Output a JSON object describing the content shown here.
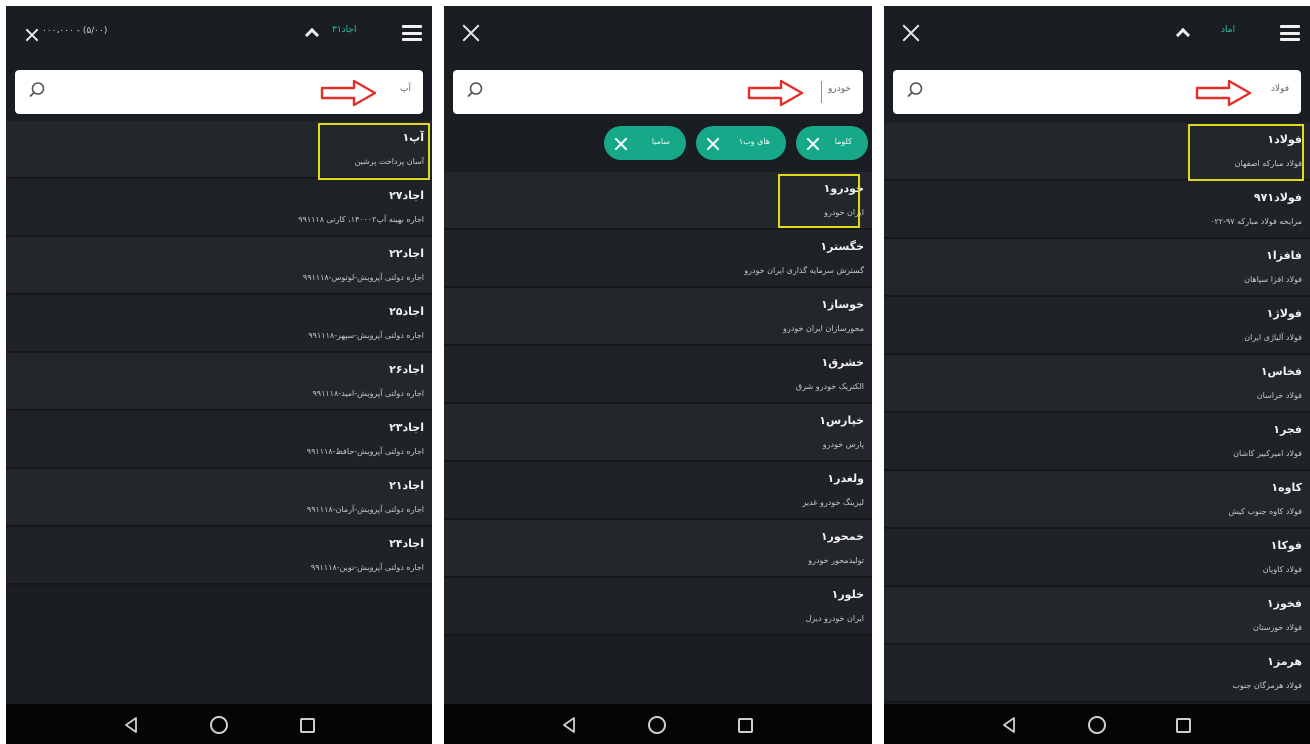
{
  "panel1": {
    "status_text": "۰۰۰،۰۰۰ - (۵/۰۰)",
    "pill_label": "اجاد۳۱",
    "search_query": "آپ",
    "items": [
      {
        "symbol": "آپ۱",
        "name": "آسان پرداخت پرشین"
      },
      {
        "symbol": "اجاد۲۷",
        "name": "اجاره بهینه آپ۱۴۰۰۰۲، کارتی ۹۹۱۱۱۸"
      },
      {
        "symbol": "اجاد۲۲",
        "name": "اجاره دولتی آپرویش-لوتوس-۹۹۱۱۱۸"
      },
      {
        "symbol": "اجاد۲۵",
        "name": "اجاره دولتی آپرویش-سپهر-۹۹۱۱۱۸"
      },
      {
        "symbol": "اجاد۲۶",
        "name": "اجاره دولتی آپرویش-امید-۹۹۱۱۱۸"
      },
      {
        "symbol": "اجاد۲۳",
        "name": "اجاره دولتی آپرویش-حافظ-۹۹۱۱۱۸"
      },
      {
        "symbol": "اجاد۲۱",
        "name": "اجاره دولتی آپرویش-آرمان-۹۹۱۱۱۸"
      },
      {
        "symbol": "اجاد۲۴",
        "name": "اجاره دولتی آپرویش-نوین-۹۹۱۱۱۸"
      }
    ]
  },
  "panel2": {
    "search_query": "خودرو",
    "chips": [
      "کلوما",
      "های وب۱",
      "سامیا"
    ],
    "items": [
      {
        "symbol": "خودرو۱",
        "name": "ایران خودرو"
      },
      {
        "symbol": "خگستر۱",
        "name": "گسترش سرمایه گذاری ایران خودرو"
      },
      {
        "symbol": "خوساز۱",
        "name": "محورسازان ایران خودرو"
      },
      {
        "symbol": "خشرق۱",
        "name": "الکتریک خودرو شرق"
      },
      {
        "symbol": "خپارس۱",
        "name": "پارس خودرو"
      },
      {
        "symbol": "ولغدر۱",
        "name": "لیزینگ خودرو غدیر"
      },
      {
        "symbol": "خمحور۱",
        "name": "تولیدمحور خودرو"
      },
      {
        "symbol": "خلور۱",
        "name": "ایران خودرو دیزل"
      }
    ]
  },
  "panel3": {
    "pill_label": "اماد",
    "search_query": "فولاد",
    "items": [
      {
        "symbol": "فولاد۱",
        "name": "فولاد مبارکه اصفهان"
      },
      {
        "symbol": "فولاد۹۷۱",
        "name": "مرابحه فولاد مبارکه ۹۷-۰۲۲"
      },
      {
        "symbol": "فافزا۱",
        "name": "فولاد افزا سپاهان"
      },
      {
        "symbol": "فولاژ۱",
        "name": "فولاد آلیاژی ایران"
      },
      {
        "symbol": "فخاس۱",
        "name": "فولاد خراسان"
      },
      {
        "symbol": "فجر۱",
        "name": "فولاد امیرکبیر کاشان"
      },
      {
        "symbol": "کاوه۱",
        "name": "فولاد کاوه جنوب کیش"
      },
      {
        "symbol": "فوکا۱",
        "name": "فولاد کاویان"
      },
      {
        "symbol": "فخوز۱",
        "name": "فولاد خوزستان"
      },
      {
        "symbol": "هرمز۱",
        "name": "فولاد هرمزگان جنوب"
      }
    ]
  },
  "colors": {
    "accent": "#17a88a",
    "highlight": "#e3d91c",
    "arrow": "#e0302a",
    "panel_bg": "#1a1d21"
  }
}
